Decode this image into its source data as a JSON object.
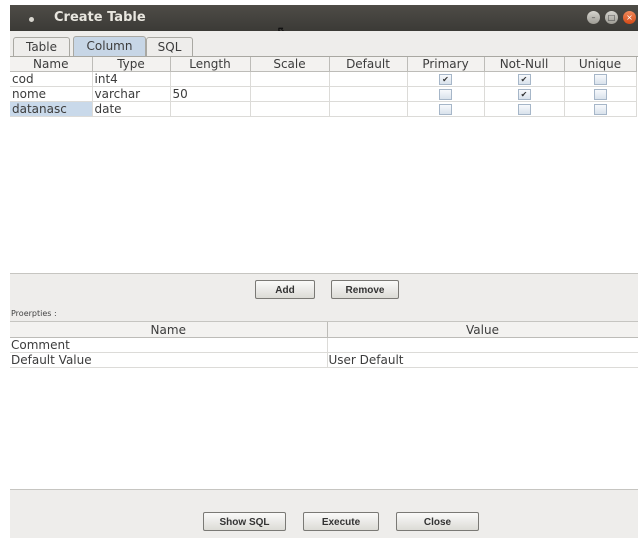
{
  "window": {
    "title": "Create Table"
  },
  "tabs": [
    {
      "label": "Table"
    },
    {
      "label": "Column"
    },
    {
      "label": "SQL"
    }
  ],
  "columns_grid": {
    "headers": [
      "Name",
      "Type",
      "Length",
      "Scale",
      "Default",
      "Primary",
      "Not-Null",
      "Unique"
    ],
    "rows": [
      {
        "name": "cod",
        "type": "int4",
        "length": "",
        "scale": "",
        "default": "",
        "primary": true,
        "not_null": true,
        "unique": false
      },
      {
        "name": "nome",
        "type": "varchar",
        "length": "50",
        "scale": "",
        "default": "",
        "primary": false,
        "not_null": true,
        "unique": false
      },
      {
        "name": "datanasc",
        "type": "date",
        "length": "",
        "scale": "",
        "default": "",
        "primary": false,
        "not_null": false,
        "unique": false
      }
    ]
  },
  "column_buttons": {
    "add": "Add",
    "remove": "Remove"
  },
  "properties": {
    "label": "Proerpties :",
    "headers": [
      "Name",
      "Value"
    ],
    "rows": [
      {
        "name": "Comment",
        "value": ""
      },
      {
        "name": "Default Value",
        "value": "User Default"
      }
    ]
  },
  "footer_buttons": {
    "show_sql": "Show SQL",
    "execute": "Execute",
    "close": "Close"
  },
  "check_glyph": "✔"
}
